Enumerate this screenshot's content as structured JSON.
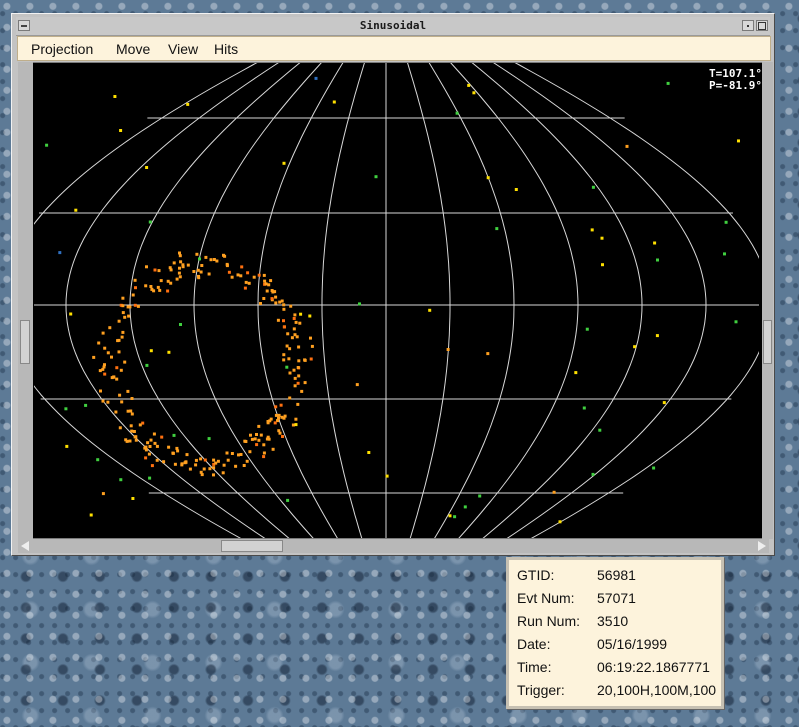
{
  "window": {
    "title": "Sinusoidal"
  },
  "menu": [
    {
      "label": "Projection"
    },
    {
      "label": "Move"
    },
    {
      "label": "View"
    },
    {
      "label": "Hits"
    }
  ],
  "readout": {
    "theta": "T=107.1°",
    "phi": "P=-81.9°"
  },
  "hit_colors": {
    "background": "#000000",
    "grid": "#d9d9d9",
    "orange": "#ffa020",
    "dark_orange": "#ff7010",
    "yellow": "#ffe000",
    "green": "#40d040",
    "blue": "#3070c0"
  },
  "info": [
    {
      "label": "GTID:",
      "value": "56981"
    },
    {
      "label": "Evt Num:",
      "value": "57071"
    },
    {
      "label": "Run Num:",
      "value": "3510"
    },
    {
      "label": "Date:",
      "value": "05/16/1999"
    },
    {
      "label": "Time:",
      "value": "06:19:22.1867771"
    },
    {
      "label": "Trigger:",
      "value": "20,100H,100M,100"
    }
  ]
}
